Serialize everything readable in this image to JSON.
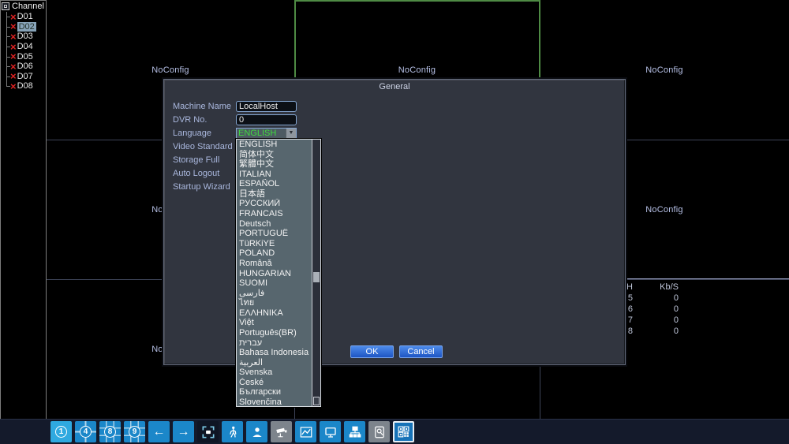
{
  "sidebar": {
    "title": "Channel",
    "items": [
      {
        "label": "D01",
        "selected": false
      },
      {
        "label": "D02",
        "selected": true
      },
      {
        "label": "D03",
        "selected": false
      },
      {
        "label": "D04",
        "selected": false
      },
      {
        "label": "D05",
        "selected": false
      },
      {
        "label": "D06",
        "selected": false
      },
      {
        "label": "D07",
        "selected": false
      },
      {
        "label": "D08",
        "selected": false
      }
    ]
  },
  "grid": {
    "no_config_label": "NoConfig",
    "selected_channel": "D02",
    "bitrate_table": {
      "headers": [
        "CH",
        "Kb/S"
      ],
      "rows": [
        [
          "5",
          "0"
        ],
        [
          "6",
          "0"
        ],
        [
          "7",
          "0"
        ],
        [
          "8",
          "0"
        ]
      ]
    }
  },
  "dialog": {
    "title": "General",
    "fields": [
      {
        "label": "Machine Name",
        "value": "LocalHost"
      },
      {
        "label": "DVR No.",
        "value": "0"
      },
      {
        "label": "Language",
        "value": "ENGLISH"
      },
      {
        "label": "Video Standard",
        "value": ""
      },
      {
        "label": "Storage Full",
        "value": ""
      },
      {
        "label": "Auto Logout",
        "value": ""
      },
      {
        "label": "Startup Wizard",
        "value": ""
      }
    ],
    "language_options": [
      "ENGLISH",
      "简体中文",
      "繁體中文",
      "ITALIAN",
      "ESPAÑOL",
      "日本語",
      "РУССКИЙ",
      "FRANCAIS",
      "Deutsch",
      "PORTUGUÊ",
      "TüRKiYE",
      "POLAND",
      "Română",
      "HUNGARIAN",
      "SUOMI",
      "فارسی",
      "ไทย",
      "ΕΛΛΗΝΙΚΑ",
      "Việt",
      "Português(BR)",
      "עברית",
      "Bahasa Indonesia",
      "العربية",
      "Svenska",
      "České",
      "Български",
      "Slovenčina"
    ],
    "ok_label": "OK",
    "cancel_label": "Cancel"
  },
  "toolbar": {
    "buttons": [
      {
        "name": "view-1",
        "label": "1"
      },
      {
        "name": "view-4",
        "label": "4"
      },
      {
        "name": "view-8",
        "label": "8"
      },
      {
        "name": "view-9",
        "label": "9"
      },
      {
        "name": "prev",
        "glyph": "←"
      },
      {
        "name": "next",
        "glyph": "→"
      },
      {
        "name": "fullscreen"
      },
      {
        "name": "motion-detect"
      },
      {
        "name": "user"
      },
      {
        "name": "ptz-camera"
      },
      {
        "name": "playback-chart"
      },
      {
        "name": "monitor"
      },
      {
        "name": "network"
      },
      {
        "name": "disk-search"
      },
      {
        "name": "channel-mosaic"
      }
    ]
  },
  "colors": {
    "toolbar_button_blue": "#1b87c9",
    "toolbar_button_active": "#2fa9e0",
    "toolbar_button_gray": "#7d848c",
    "selected_cell_border_green": "#4e8a44",
    "language_value_green": "#3fdb3f",
    "dialog_label_blue": "#a9b7dd",
    "noconfig_text": "#b6c0e6",
    "dialog_background": "#31353f",
    "dropdown_background": "#57666e",
    "ok_cancel_blue": "#2e6fd9",
    "channel_x_red": "#e02222"
  }
}
